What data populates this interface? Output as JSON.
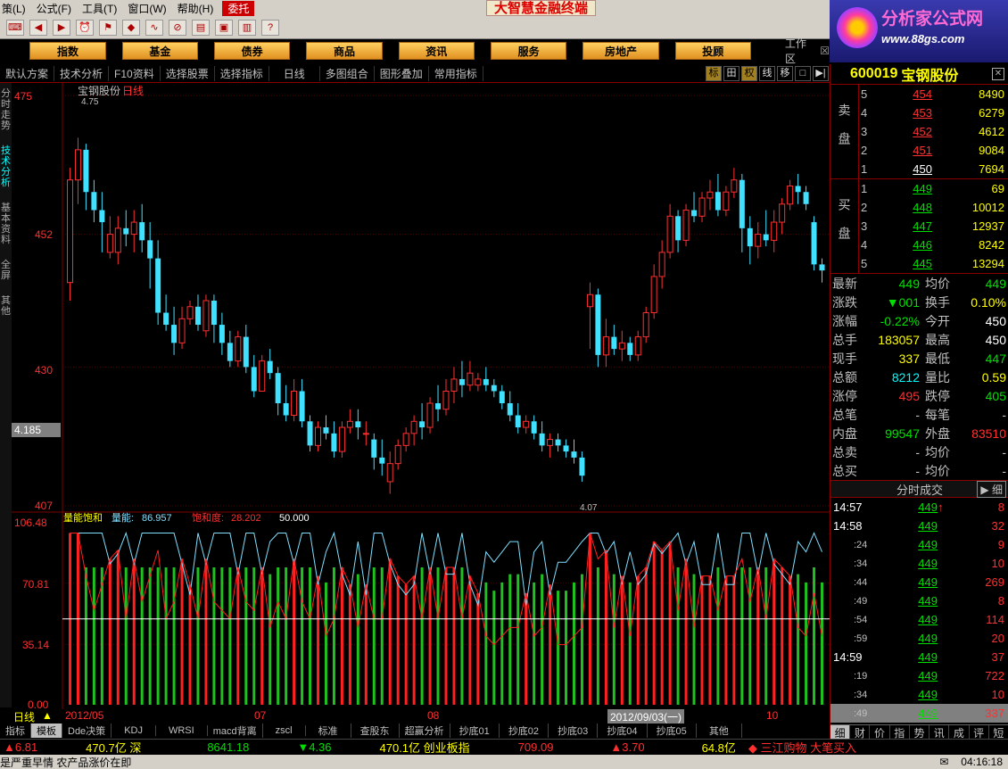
{
  "menu": {
    "items": [
      "策(L)",
      "公式(F)",
      "工具(T)",
      "窗口(W)",
      "帮助(H)",
      "委托"
    ],
    "app_title": "大智慧金融终端"
  },
  "logo": {
    "title": "分析家公式网",
    "url": "www.88gs.com"
  },
  "categories": [
    "指数",
    "基金",
    "债券",
    "商品",
    "资讯",
    "服务",
    "房地产",
    "投顾"
  ],
  "workarea_label": "工作区",
  "funcbar": {
    "items": [
      "默认方案",
      "技术分析",
      "F10资料",
      "选择股票",
      "选择指标",
      "日线",
      "多图组合",
      "图形叠加",
      "常用指标"
    ],
    "icons": [
      "标",
      "田",
      "权",
      "线",
      "移",
      "□",
      "▶|"
    ]
  },
  "vtabs": [
    "分时走势",
    "技术分析",
    "基本资料",
    "全屏",
    "其他"
  ],
  "chart": {
    "title": "宝钢股份",
    "period": "日线",
    "y_ticks": [
      "475",
      "452",
      "430",
      "407"
    ],
    "high_label": "4.75",
    "low_label": "4.07",
    "cursor_price": "4.185",
    "indicator": {
      "name": "量能饱和",
      "line1_label": "量能:",
      "line1_value": "86.957",
      "line2_label": "饱和度:",
      "line2_value": "28.202",
      "line3_value": "50.000",
      "y_ticks": [
        "106.48",
        "70.81",
        "35.14",
        "0.00"
      ]
    },
    "period_label": "日线",
    "x_labels": [
      "2012/05",
      "07",
      "08",
      "2012/09/03(一)",
      "10"
    ]
  },
  "chart_data": {
    "type": "candlestick",
    "title": "宝钢股份",
    "ylim": [
      407,
      475
    ],
    "candles": [
      {
        "o": 444,
        "h": 463,
        "l": 441,
        "c": 461
      },
      {
        "o": 461,
        "h": 468,
        "l": 457,
        "c": 466
      },
      {
        "o": 466,
        "h": 467,
        "l": 456,
        "c": 459
      },
      {
        "o": 459,
        "h": 461,
        "l": 454,
        "c": 456
      },
      {
        "o": 456,
        "h": 459,
        "l": 449,
        "c": 454
      },
      {
        "o": 449,
        "h": 455,
        "l": 448,
        "c": 452
      },
      {
        "o": 449,
        "h": 455,
        "l": 447,
        "c": 453
      },
      {
        "o": 453,
        "h": 456,
        "l": 450,
        "c": 452
      },
      {
        "o": 452,
        "h": 456,
        "l": 449,
        "c": 454
      },
      {
        "o": 454,
        "h": 457,
        "l": 449,
        "c": 451
      },
      {
        "o": 451,
        "h": 454,
        "l": 443,
        "c": 448
      },
      {
        "o": 448,
        "h": 451,
        "l": 437,
        "c": 439
      },
      {
        "o": 439,
        "h": 442,
        "l": 436,
        "c": 437
      },
      {
        "o": 437,
        "h": 440,
        "l": 432,
        "c": 434
      },
      {
        "o": 434,
        "h": 440,
        "l": 433,
        "c": 438
      },
      {
        "o": 438,
        "h": 441,
        "l": 437,
        "c": 440
      },
      {
        "o": 440,
        "h": 442,
        "l": 436,
        "c": 437
      },
      {
        "o": 436,
        "h": 442,
        "l": 435,
        "c": 441
      },
      {
        "o": 441,
        "h": 442,
        "l": 434,
        "c": 437
      },
      {
        "o": 437,
        "h": 439,
        "l": 432,
        "c": 434
      },
      {
        "o": 434,
        "h": 436,
        "l": 430,
        "c": 431
      },
      {
        "o": 431,
        "h": 436,
        "l": 430,
        "c": 435
      },
      {
        "o": 435,
        "h": 437,
        "l": 429,
        "c": 430
      },
      {
        "o": 430,
        "h": 432,
        "l": 425,
        "c": 426
      },
      {
        "o": 426,
        "h": 432,
        "l": 426,
        "c": 431
      },
      {
        "o": 431,
        "h": 433,
        "l": 428,
        "c": 429
      },
      {
        "o": 429,
        "h": 430,
        "l": 422,
        "c": 424
      },
      {
        "o": 424,
        "h": 427,
        "l": 421,
        "c": 422
      },
      {
        "o": 422,
        "h": 428,
        "l": 421,
        "c": 426
      },
      {
        "o": 426,
        "h": 428,
        "l": 420,
        "c": 421
      },
      {
        "o": 421,
        "h": 422,
        "l": 416,
        "c": 417
      },
      {
        "o": 417,
        "h": 421,
        "l": 416,
        "c": 420
      },
      {
        "o": 420,
        "h": 422,
        "l": 418,
        "c": 419
      },
      {
        "o": 419,
        "h": 421,
        "l": 415,
        "c": 416
      },
      {
        "o": 416,
        "h": 421,
        "l": 415,
        "c": 420
      },
      {
        "o": 420,
        "h": 423,
        "l": 419,
        "c": 421
      },
      {
        "o": 421,
        "h": 423,
        "l": 418,
        "c": 420
      },
      {
        "o": 419,
        "h": 421,
        "l": 417,
        "c": 419
      },
      {
        "o": 418,
        "h": 419,
        "l": 413,
        "c": 415
      },
      {
        "o": 415,
        "h": 418,
        "l": 412,
        "c": 414
      },
      {
        "o": 411,
        "h": 416,
        "l": 409,
        "c": 414
      },
      {
        "o": 414,
        "h": 418,
        "l": 413,
        "c": 417
      },
      {
        "o": 417,
        "h": 420,
        "l": 416,
        "c": 419
      },
      {
        "o": 419,
        "h": 422,
        "l": 417,
        "c": 421
      },
      {
        "o": 421,
        "h": 424,
        "l": 418,
        "c": 420
      },
      {
        "o": 420,
        "h": 425,
        "l": 419,
        "c": 424
      },
      {
        "o": 424,
        "h": 427,
        "l": 421,
        "c": 423
      },
      {
        "o": 423,
        "h": 428,
        "l": 422,
        "c": 426
      },
      {
        "o": 426,
        "h": 430,
        "l": 424,
        "c": 428
      },
      {
        "o": 428,
        "h": 431,
        "l": 425,
        "c": 427
      },
      {
        "o": 427,
        "h": 431,
        "l": 426,
        "c": 429
      },
      {
        "o": 427,
        "h": 429,
        "l": 426,
        "c": 428
      },
      {
        "o": 428,
        "h": 430,
        "l": 426,
        "c": 427
      },
      {
        "o": 427,
        "h": 428,
        "l": 425,
        "c": 426
      },
      {
        "o": 426,
        "h": 427,
        "l": 423,
        "c": 424
      },
      {
        "o": 424,
        "h": 426,
        "l": 421,
        "c": 422
      },
      {
        "o": 422,
        "h": 424,
        "l": 419,
        "c": 420
      },
      {
        "o": 420,
        "h": 422,
        "l": 419,
        "c": 421
      },
      {
        "o": 421,
        "h": 422,
        "l": 418,
        "c": 419
      },
      {
        "o": 419,
        "h": 421,
        "l": 416,
        "c": 417
      },
      {
        "o": 417,
        "h": 419,
        "l": 415,
        "c": 418
      },
      {
        "o": 418,
        "h": 419,
        "l": 416,
        "c": 417
      },
      {
        "o": 417,
        "h": 418,
        "l": 415,
        "c": 416
      },
      {
        "o": 416,
        "h": 418,
        "l": 414,
        "c": 415
      },
      {
        "o": 415,
        "h": 416,
        "l": 411,
        "c": 412
      },
      {
        "o": 440,
        "h": 444,
        "l": 433,
        "c": 442
      },
      {
        "o": 442,
        "h": 443,
        "l": 430,
        "c": 432
      },
      {
        "o": 432,
        "h": 438,
        "l": 430,
        "c": 435
      },
      {
        "o": 435,
        "h": 437,
        "l": 432,
        "c": 433
      },
      {
        "o": 433,
        "h": 436,
        "l": 431,
        "c": 434
      },
      {
        "o": 434,
        "h": 435,
        "l": 431,
        "c": 432
      },
      {
        "o": 432,
        "h": 436,
        "l": 431,
        "c": 435
      },
      {
        "o": 435,
        "h": 440,
        "l": 434,
        "c": 439
      },
      {
        "o": 439,
        "h": 447,
        "l": 438,
        "c": 445
      },
      {
        "o": 445,
        "h": 451,
        "l": 443,
        "c": 449
      },
      {
        "o": 449,
        "h": 457,
        "l": 448,
        "c": 455
      },
      {
        "o": 455,
        "h": 456,
        "l": 449,
        "c": 451
      },
      {
        "o": 451,
        "h": 457,
        "l": 450,
        "c": 456
      },
      {
        "o": 456,
        "h": 459,
        "l": 454,
        "c": 455
      },
      {
        "o": 455,
        "h": 459,
        "l": 454,
        "c": 458
      },
      {
        "o": 458,
        "h": 461,
        "l": 456,
        "c": 459
      },
      {
        "o": 459,
        "h": 462,
        "l": 455,
        "c": 456
      },
      {
        "o": 456,
        "h": 460,
        "l": 455,
        "c": 459
      },
      {
        "o": 459,
        "h": 463,
        "l": 458,
        "c": 461
      },
      {
        "o": 461,
        "h": 462,
        "l": 449,
        "c": 453
      },
      {
        "o": 453,
        "h": 455,
        "l": 447,
        "c": 450
      },
      {
        "o": 450,
        "h": 454,
        "l": 448,
        "c": 452
      },
      {
        "o": 452,
        "h": 456,
        "l": 450,
        "c": 451
      },
      {
        "o": 451,
        "h": 456,
        "l": 449,
        "c": 454
      },
      {
        "o": 454,
        "h": 458,
        "l": 452,
        "c": 457
      },
      {
        "o": 457,
        "h": 461,
        "l": 456,
        "c": 460
      },
      {
        "o": 460,
        "h": 462,
        "l": 457,
        "c": 459
      },
      {
        "o": 459,
        "h": 460,
        "l": 456,
        "c": 457
      },
      {
        "o": 454,
        "h": 455,
        "l": 446,
        "c": 447
      },
      {
        "o": 447,
        "h": 448,
        "l": 444,
        "c": 446
      }
    ],
    "indicator": {
      "name": "量能饱和",
      "ylim": [
        0,
        106.48
      ],
      "ref_line": 50.0,
      "series": [
        {
          "name": "量能",
          "color": "#80e0ff"
        },
        {
          "name": "饱和度",
          "color": "#ff2020"
        }
      ]
    }
  },
  "order_book": {
    "code": "600019",
    "name": "宝钢股份",
    "sell_label": "卖盘",
    "buy_label": "买盘",
    "sell": [
      {
        "level": "5",
        "price": "454",
        "vol": "8490"
      },
      {
        "level": "4",
        "price": "453",
        "vol": "6279"
      },
      {
        "level": "3",
        "price": "452",
        "vol": "4612"
      },
      {
        "level": "2",
        "price": "451",
        "vol": "9084"
      },
      {
        "level": "1",
        "price": "450",
        "vol": "7694"
      }
    ],
    "buy": [
      {
        "level": "1",
        "price": "449",
        "vol": "69"
      },
      {
        "level": "2",
        "price": "448",
        "vol": "10012"
      },
      {
        "level": "3",
        "price": "447",
        "vol": "12937"
      },
      {
        "level": "4",
        "price": "446",
        "vol": "8242"
      },
      {
        "level": "5",
        "price": "445",
        "vol": "13294"
      }
    ]
  },
  "quote": [
    {
      "k": "最新",
      "v": "449",
      "vc": "grn",
      "k2": "均价",
      "v2": "449",
      "v2c": "grn"
    },
    {
      "k": "涨跌",
      "v": "▼001",
      "vc": "grn",
      "k2": "换手",
      "v2": "0.10%",
      "v2c": "yel"
    },
    {
      "k": "涨幅",
      "v": "-0.22%",
      "vc": "grn",
      "k2": "今开",
      "v2": "450",
      "v2c": "wht"
    },
    {
      "k": "总手",
      "v": "183057",
      "vc": "yel",
      "k2": "最高",
      "v2": "450",
      "v2c": "wht"
    },
    {
      "k": "现手",
      "v": "337",
      "vc": "yel",
      "k2": "最低",
      "v2": "447",
      "v2c": "grn"
    },
    {
      "k": "总额",
      "v": "8212",
      "vc": "cyn",
      "k2": "量比",
      "v2": "0.59",
      "v2c": "yel"
    },
    {
      "k": "涨停",
      "v": "495",
      "vc": "red",
      "k2": "跌停",
      "v2": "405",
      "v2c": "grn"
    },
    {
      "k": "总笔",
      "v": "-",
      "vc": "gry",
      "k2": "每笔",
      "v2": "-",
      "v2c": "gry"
    },
    {
      "k": "内盘",
      "v": "99547",
      "vc": "grn",
      "k2": "外盘",
      "v2": "83510",
      "v2c": "red"
    },
    {
      "k": "总卖",
      "v": "-",
      "vc": "gry",
      "k2": "均价",
      "v2": "-",
      "v2c": "gry"
    },
    {
      "k": "总买",
      "v": "-",
      "vc": "gry",
      "k2": "均价",
      "v2": "-",
      "v2c": "gry"
    }
  ],
  "trades": {
    "title": "分时成交",
    "button": "细",
    "rows": [
      {
        "t": "14:57",
        "p": "449",
        "a": "↑",
        "v": "8",
        "vc": "red",
        "sub": false
      },
      {
        "t": "14:58",
        "p": "449",
        "a": "",
        "v": "32",
        "vc": "red",
        "sub": false
      },
      {
        "t": ":24",
        "p": "449",
        "a": "",
        "v": "9",
        "vc": "red",
        "sub": true
      },
      {
        "t": ":34",
        "p": "449",
        "a": "",
        "v": "10",
        "vc": "red",
        "sub": true
      },
      {
        "t": ":44",
        "p": "449",
        "a": "",
        "v": "269",
        "vc": "red",
        "sub": true
      },
      {
        "t": ":49",
        "p": "449",
        "a": "",
        "v": "8",
        "vc": "red",
        "sub": true
      },
      {
        "t": ":54",
        "p": "449",
        "a": "",
        "v": "114",
        "vc": "red",
        "sub": true
      },
      {
        "t": ":59",
        "p": "449",
        "a": "",
        "v": "20",
        "vc": "red",
        "sub": true
      },
      {
        "t": "14:59",
        "p": "449",
        "a": "",
        "v": "37",
        "vc": "red",
        "sub": false
      },
      {
        "t": ":19",
        "p": "449",
        "a": "",
        "v": "722",
        "vc": "red",
        "sub": true
      },
      {
        "t": ":34",
        "p": "449",
        "a": "",
        "v": "10",
        "vc": "red",
        "sub": true
      },
      {
        "t": ":49",
        "p": "449",
        "a": "",
        "v": "337",
        "vc": "red",
        "sub": true
      }
    ]
  },
  "right_tabs": [
    "细",
    "财",
    "价",
    "指",
    "势",
    "讯",
    "成",
    "评",
    "短"
  ],
  "bottom_tabs": [
    "指标",
    "模板",
    "Dde决策",
    "KDJ",
    "WRSI",
    "macd背离",
    "zscl",
    "标准",
    "查股东",
    "超赢分析",
    "抄底01",
    "抄底02",
    "抄底03",
    "抄底04",
    "抄底05",
    "其他"
  ],
  "ticker": [
    {
      "text": "▲6.81",
      "c": "red"
    },
    {
      "text": "470.7亿 深",
      "c": "yel"
    },
    {
      "text": "8641.18",
      "c": "grn"
    },
    {
      "text": "▼4.36",
      "c": "grn"
    },
    {
      "text": "470.1亿 创业板指",
      "c": "yel"
    },
    {
      "text": "709.09",
      "c": "red"
    },
    {
      "text": "▲3.70",
      "c": "red"
    },
    {
      "text": "64.8亿",
      "c": "yel"
    },
    {
      "text": "◆ 三江购物 大笔买入",
      "c": "red"
    }
  ],
  "status": {
    "news": "是严重早情 农产品涨价在即",
    "time": "04:16:18"
  }
}
